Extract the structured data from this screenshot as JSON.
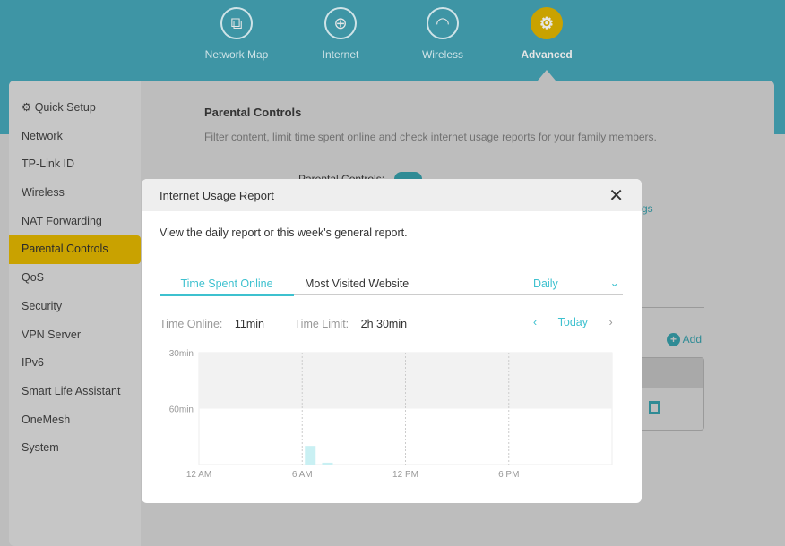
{
  "nav": [
    {
      "label": "Network Map",
      "icon": "network-map-icon"
    },
    {
      "label": "Internet",
      "icon": "globe-icon"
    },
    {
      "label": "Wireless",
      "icon": "wifi-icon"
    },
    {
      "label": "Advanced",
      "icon": "gear-icon",
      "active": true
    }
  ],
  "sidebar": {
    "items": [
      "Quick Setup",
      "Network",
      "TP-Link ID",
      "Wireless",
      "NAT Forwarding",
      "Parental Controls",
      "QoS",
      "Security",
      "VPN Server",
      "IPv6",
      "Smart Life Assistant",
      "OneMesh",
      "System"
    ],
    "active": "Parental Controls"
  },
  "page": {
    "title": "Parental Controls",
    "description": "Filter content, limit time spent online and check internet usage reports for your family members.",
    "toggle_label": "Parental Controls:",
    "add_label": "Add",
    "link_fragment": "gs"
  },
  "modal": {
    "title": "Internet Usage Report",
    "intro": "View the daily report or this week's general report.",
    "tabs": [
      "Time Spent Online",
      "Most Visited Website"
    ],
    "period": "Daily",
    "time_online_label": "Time Online:",
    "time_online": "11min",
    "time_limit_label": "Time Limit:",
    "time_limit": "2h 30min",
    "day": "Today"
  },
  "colors": {
    "accent": "#3ec1cf",
    "active": "#c9a200",
    "bar": "#c9f0f3"
  },
  "chart_data": {
    "type": "bar",
    "x_unit": "hour",
    "xlim": [
      0,
      24
    ],
    "ylim": [
      0,
      60
    ],
    "y_ticks": [
      "30min",
      "60min"
    ],
    "x_ticks": [
      "12 AM",
      "6 AM",
      "12 PM",
      "6 PM"
    ],
    "limit_shading_above": 30,
    "bars": [
      {
        "hour": 6,
        "minutes": 10
      },
      {
        "hour": 7,
        "minutes": 1
      }
    ],
    "grid": "vertical dashed"
  }
}
